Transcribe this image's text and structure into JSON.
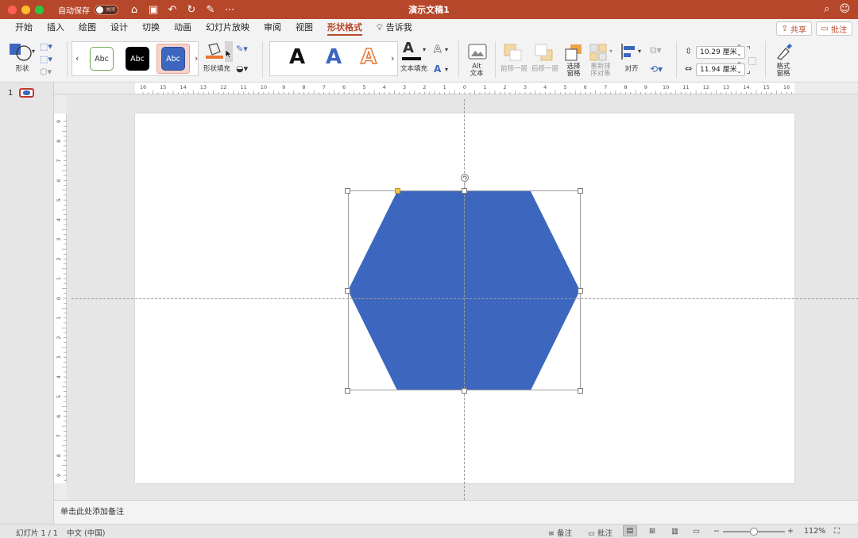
{
  "titlebar": {
    "autosave_label": "自动保存",
    "autosave_state": "关闭",
    "document_title": "演示文稿1"
  },
  "tabs": [
    "开始",
    "插入",
    "绘图",
    "设计",
    "切换",
    "动画",
    "幻灯片放映",
    "审阅",
    "视图",
    "形状格式"
  ],
  "active_tab": "形状格式",
  "tell_me": "告诉我",
  "share_label": "共享",
  "comment_label": "批注",
  "ribbon": {
    "shapes_label": "形状",
    "style_tiles": [
      "Abc",
      "Abc",
      "Abc"
    ],
    "shape_fill_label": "形状填充",
    "text_fill_label": "文本填充",
    "wordart_letter": "A",
    "alt_text_label_1": "Alt",
    "alt_text_label_2": "文本",
    "bring_forward_label": "前移一层",
    "send_backward_label": "后移一层",
    "selection_pane_label_1": "选择",
    "selection_pane_label_2": "窗格",
    "reorder_label_1": "重新排",
    "reorder_label_2": "序对象",
    "align_label": "对齐",
    "height_value": "10.29 厘米",
    "width_value": "11.94 厘米",
    "format_pane_label_1": "格式",
    "format_pane_label_2": "窗格",
    "gallery_prev": "‹",
    "gallery_next": "›"
  },
  "hruler_labels": [
    "16",
    "15",
    "14",
    "13",
    "12",
    "11",
    "10",
    "9",
    "8",
    "7",
    "6",
    "5",
    "4",
    "3",
    "2",
    "1",
    "0",
    "1",
    "2",
    "3",
    "4",
    "5",
    "6",
    "7",
    "8",
    "9",
    "10",
    "11",
    "12",
    "13",
    "14",
    "15",
    "16"
  ],
  "vruler_labels": [
    "9",
    "8",
    "7",
    "6",
    "5",
    "4",
    "3",
    "2",
    "1",
    "0",
    "1",
    "2",
    "3",
    "4",
    "5",
    "6",
    "7",
    "8",
    "9"
  ],
  "slide_pane": {
    "slide_number": "1"
  },
  "notes_placeholder": "单击此处添加备注",
  "statusbar": {
    "slide_info": "幻灯片 1 / 1",
    "language": "中文 (中国)",
    "notes_label": "备注",
    "comments_label": "批注",
    "zoom": "112%"
  },
  "colors": {
    "accent": "#b7472a",
    "shape_fill": "#3d67bf",
    "fill_swatch": "#e8772e"
  }
}
